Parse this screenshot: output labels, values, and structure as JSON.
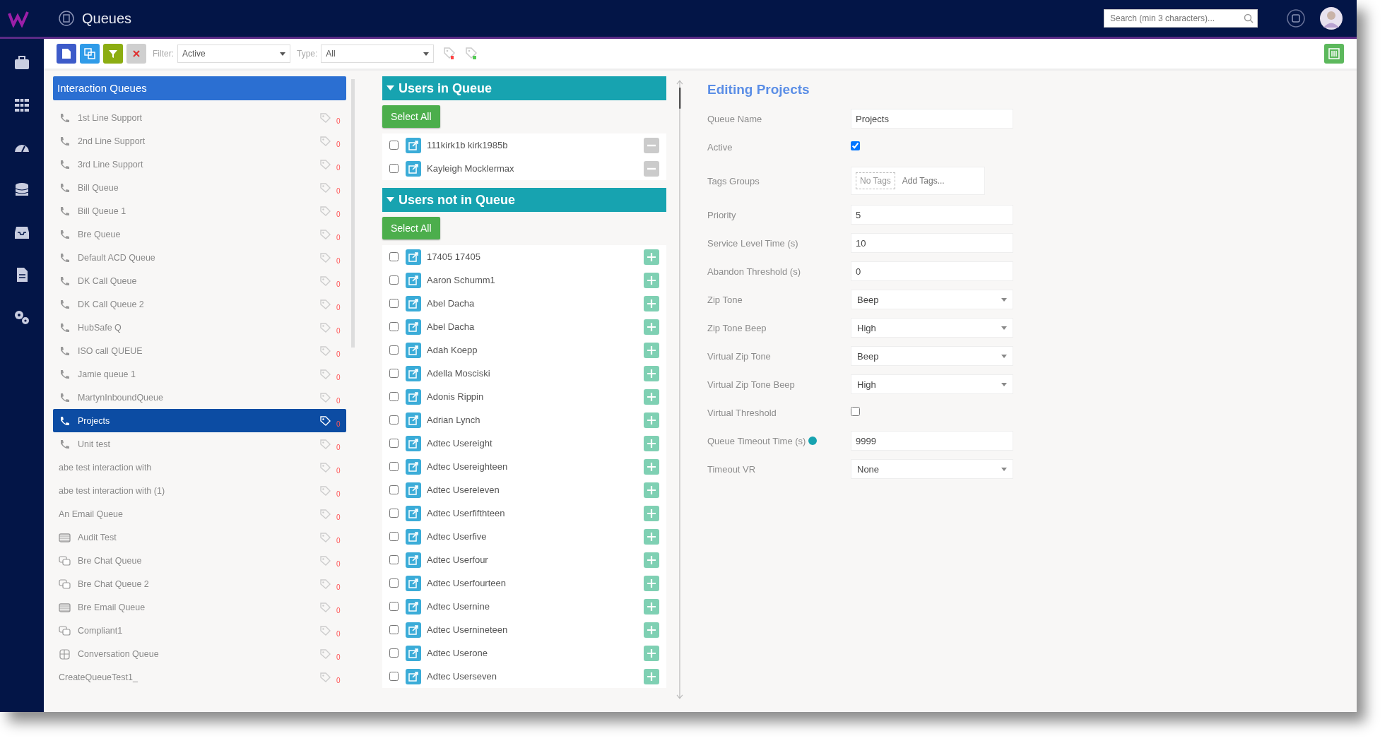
{
  "header": {
    "title": "Queues",
    "search": {
      "placeholder": "Search (min 3 characters)..."
    }
  },
  "toolbar": {
    "filter": {
      "label": "Filter:",
      "value": "Active"
    },
    "type": {
      "label": "Type:",
      "value": "All"
    }
  },
  "queues": {
    "title": "Interaction Queues",
    "items": [
      {
        "label": "1st Line Support",
        "kind": "phone",
        "count": "0",
        "selected": false
      },
      {
        "label": "2nd Line Support",
        "kind": "phone",
        "count": "0",
        "selected": false
      },
      {
        "label": "3rd Line Support",
        "kind": "phone",
        "count": "0",
        "selected": false
      },
      {
        "label": "Bill Queue",
        "kind": "phone",
        "count": "0",
        "selected": false
      },
      {
        "label": "Bill Queue 1",
        "kind": "phone",
        "count": "0",
        "selected": false
      },
      {
        "label": "Bre Queue",
        "kind": "phone",
        "count": "0",
        "selected": false
      },
      {
        "label": "Default ACD Queue",
        "kind": "phone",
        "count": "0",
        "selected": false
      },
      {
        "label": "DK Call Queue",
        "kind": "phone",
        "count": "0",
        "selected": false
      },
      {
        "label": "DK Call Queue 2",
        "kind": "phone",
        "count": "0",
        "selected": false
      },
      {
        "label": "HubSafe Q",
        "kind": "phone",
        "count": "0",
        "selected": false
      },
      {
        "label": "ISO call QUEUE",
        "kind": "phone",
        "count": "0",
        "selected": false
      },
      {
        "label": "Jamie queue 1",
        "kind": "phone",
        "count": "0",
        "selected": false
      },
      {
        "label": "MartynInboundQueue",
        "kind": "phone",
        "count": "0",
        "selected": false
      },
      {
        "label": "Projects",
        "kind": "phone",
        "count": "0",
        "selected": true
      },
      {
        "label": "Unit test",
        "kind": "phone",
        "count": "0",
        "selected": false
      },
      {
        "label": "abe test interaction with",
        "kind": "none",
        "count": "0",
        "selected": false
      },
      {
        "label": "abe test interaction with (1)",
        "kind": "none",
        "count": "0",
        "selected": false
      },
      {
        "label": "An Email Queue",
        "kind": "none",
        "count": "0",
        "selected": false
      },
      {
        "label": "Audit Test",
        "kind": "email",
        "count": "0",
        "selected": false
      },
      {
        "label": "Bre Chat Queue",
        "kind": "chat",
        "count": "0",
        "selected": false
      },
      {
        "label": "Bre Chat Queue 2",
        "kind": "chat",
        "count": "0",
        "selected": false
      },
      {
        "label": "Bre Email Queue",
        "kind": "email",
        "count": "0",
        "selected": false
      },
      {
        "label": "Compliant1",
        "kind": "chat",
        "count": "0",
        "selected": false
      },
      {
        "label": "Conversation Queue",
        "kind": "conversation",
        "count": "0",
        "selected": false
      },
      {
        "label": "CreateQueueTest1_",
        "kind": "none",
        "count": "0",
        "selected": false
      }
    ]
  },
  "users_in_queue": {
    "title": "Users in Queue",
    "expanded": true,
    "select_all": "Select All",
    "kind": "remove",
    "users": [
      {
        "name": "111kirk1b kirk1985b",
        "checked": false
      },
      {
        "name": "Kayleigh Mocklermax",
        "checked": false
      }
    ]
  },
  "users_not_in_queue": {
    "title": "Users not in Queue",
    "expanded": true,
    "select_all": "Select All",
    "kind": "add",
    "users": [
      {
        "name": "17405 17405",
        "checked": false
      },
      {
        "name": "Aaron Schumm1",
        "checked": false
      },
      {
        "name": "Abel Dacha",
        "checked": false
      },
      {
        "name": "Abel Dacha",
        "checked": false
      },
      {
        "name": "Adah Koepp",
        "checked": false
      },
      {
        "name": "Adella Mosciski",
        "checked": false
      },
      {
        "name": "Adonis Rippin",
        "checked": false
      },
      {
        "name": "Adrian Lynch",
        "checked": false
      },
      {
        "name": "Adtec Usereight",
        "checked": false
      },
      {
        "name": "Adtec Usereighteen",
        "checked": false
      },
      {
        "name": "Adtec Usereleven",
        "checked": false
      },
      {
        "name": "Adtec Userfifthteen",
        "checked": false
      },
      {
        "name": "Adtec Userfive",
        "checked": false
      },
      {
        "name": "Adtec Userfour",
        "checked": false
      },
      {
        "name": "Adtec Userfourteen",
        "checked": false
      },
      {
        "name": "Adtec Usernine",
        "checked": false
      },
      {
        "name": "Adtec Usernineteen",
        "checked": false
      },
      {
        "name": "Adtec Userone",
        "checked": false
      },
      {
        "name": "Adtec Userseven",
        "checked": false
      }
    ]
  },
  "editor": {
    "title": "Editing Projects",
    "fields": [
      {
        "label": "Queue Name",
        "kind": "text",
        "value": "Projects"
      },
      {
        "label": "Active",
        "kind": "checkbox",
        "checked": true
      },
      {
        "label": "Tags Groups",
        "kind": "tags",
        "tags": [
          "No Tags"
        ],
        "placeholder": "Add Tags..."
      },
      {
        "label": "Priority",
        "kind": "text",
        "value": "5"
      },
      {
        "label": "Service Level Time (s)",
        "kind": "text",
        "value": "10"
      },
      {
        "label": "Abandon Threshold (s)",
        "kind": "text",
        "value": "0"
      },
      {
        "label": "Zip Tone",
        "kind": "select",
        "value": "Beep"
      },
      {
        "label": "Zip Tone Beep",
        "kind": "select",
        "value": "High"
      },
      {
        "label": "Virtual Zip Tone",
        "kind": "select",
        "value": "Beep"
      },
      {
        "label": "Virtual Zip Tone Beep",
        "kind": "select",
        "value": "High"
      },
      {
        "label": "Virtual Threshold",
        "kind": "checkbox",
        "checked": false
      },
      {
        "label": "Queue Timeout Time (s)",
        "kind": "text",
        "value": "9999",
        "info": true
      },
      {
        "label": "Timeout VR",
        "kind": "select",
        "value": "None"
      }
    ]
  }
}
